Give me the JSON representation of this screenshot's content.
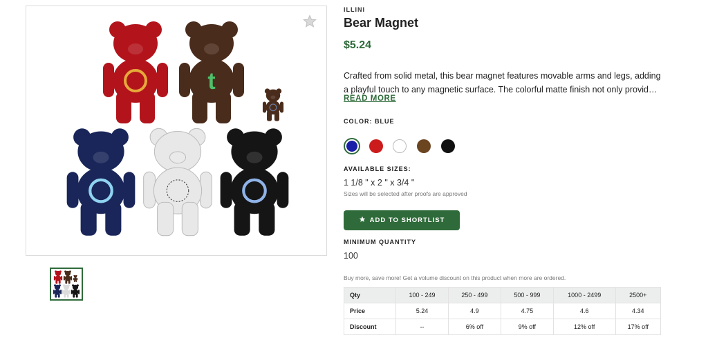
{
  "product": {
    "brand": "ILLINI",
    "title": "Bear Magnet",
    "price": "$5.24",
    "description": "Crafted from solid metal, this bear magnet features movable arms and legs, adding a playful touch to any magnetic surface. The colorful matte finish not only provides a...",
    "read_more": "READ MORE"
  },
  "colors": {
    "label": "COLOR: BLUE",
    "selected": "blue",
    "options": [
      {
        "name": "blue",
        "hex": "#1a1fa8"
      },
      {
        "name": "red",
        "hex": "#cc1b1b"
      },
      {
        "name": "white",
        "hex": "#ffffff"
      },
      {
        "name": "brown",
        "hex": "#6b4420"
      },
      {
        "name": "black",
        "hex": "#111111"
      }
    ]
  },
  "sizes": {
    "label": "AVAILABLE SIZES:",
    "value": "1 1/8 \" x 2 \" x 3/4 \"",
    "note": "Sizes will be selected after proofs are approved"
  },
  "shortlist_button": {
    "label": "ADD TO SHORTLIST",
    "icon": "star-icon"
  },
  "minimum": {
    "label": "MINIMUM QUANTITY",
    "value": "100"
  },
  "discount_note": "Buy more, save more! Get a volume discount on this product when more are ordered.",
  "pricing_table": {
    "headers": [
      "Qty",
      "100 - 249",
      "250 - 499",
      "500 - 999",
      "1000 - 2499",
      "2500+"
    ],
    "rows": [
      {
        "label": "Price",
        "cells": [
          "5.24",
          "4.9",
          "4.75",
          "4.6",
          "4.34"
        ]
      },
      {
        "label": "Discount",
        "cells": [
          "--",
          "6% off",
          "9% off",
          "12% off",
          "17% off"
        ]
      }
    ]
  },
  "image": {
    "favorite_icon": "star-icon",
    "bears": [
      {
        "color": "#b3141c",
        "logo": "Q",
        "logo_color": "#e6a93a"
      },
      {
        "color": "#4a2c1c",
        "logo": "t",
        "logo_color": "#4fbf6a"
      },
      {
        "color": "#4a2c1c",
        "logo": "",
        "logo_color": "#6a7aa0"
      },
      {
        "color": "#1a2659",
        "logo": "O",
        "logo_color": "#8fd3f0"
      },
      {
        "color": "#e8e8e8",
        "logo": "",
        "logo_color": "#333333"
      },
      {
        "color": "#151515",
        "logo": "",
        "logo_color": "#8fb3e8"
      }
    ]
  }
}
